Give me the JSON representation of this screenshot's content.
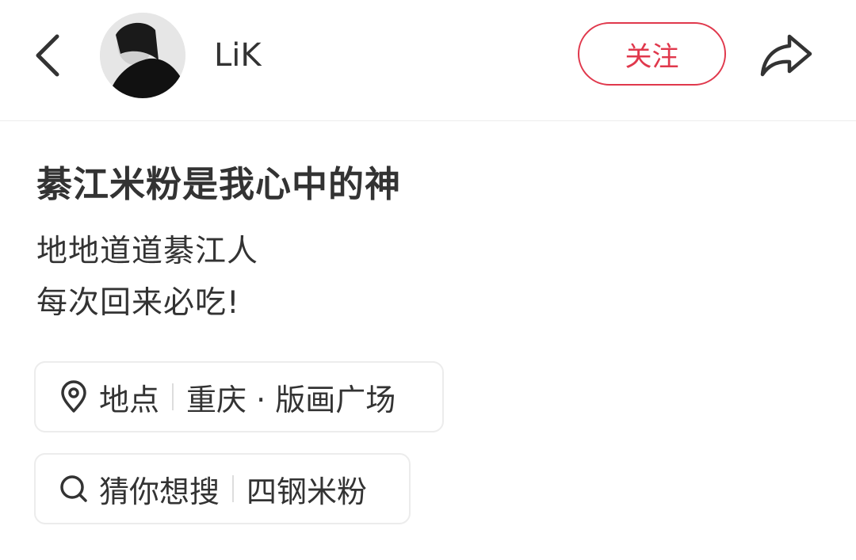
{
  "header": {
    "user_name": "LiK",
    "follow_label": "关注"
  },
  "post": {
    "title": "綦江米粉是我心中的神",
    "lines": [
      "地地道道綦江人",
      "每次回来必吃!"
    ]
  },
  "location_chip": {
    "label": "地点",
    "value": "重庆 · 版画广场"
  },
  "search_chip": {
    "label": "猜你想搜",
    "value": "四钢米粉"
  },
  "colors": {
    "accent": "#e0384c",
    "text": "#333333",
    "border": "#ececec"
  },
  "icons": [
    "back-arrow-icon",
    "share-icon",
    "location-pin-icon",
    "search-icon"
  ]
}
